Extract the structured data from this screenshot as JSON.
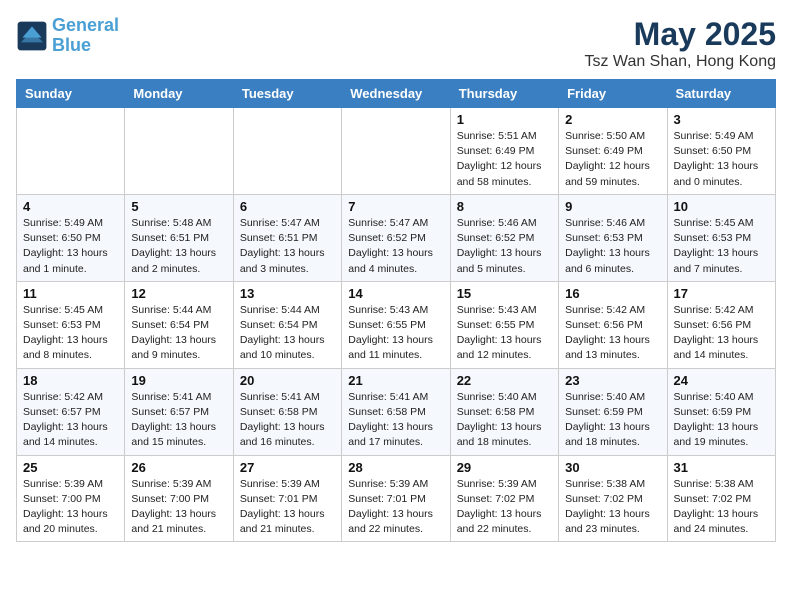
{
  "header": {
    "logo_line1": "General",
    "logo_line2": "Blue",
    "month_title": "May 2025",
    "location": "Tsz Wan Shan, Hong Kong"
  },
  "days_of_week": [
    "Sunday",
    "Monday",
    "Tuesday",
    "Wednesday",
    "Thursday",
    "Friday",
    "Saturday"
  ],
  "weeks": [
    [
      {
        "day": "",
        "info": ""
      },
      {
        "day": "",
        "info": ""
      },
      {
        "day": "",
        "info": ""
      },
      {
        "day": "",
        "info": ""
      },
      {
        "day": "1",
        "info": "Sunrise: 5:51 AM\nSunset: 6:49 PM\nDaylight: 12 hours\nand 58 minutes."
      },
      {
        "day": "2",
        "info": "Sunrise: 5:50 AM\nSunset: 6:49 PM\nDaylight: 12 hours\nand 59 minutes."
      },
      {
        "day": "3",
        "info": "Sunrise: 5:49 AM\nSunset: 6:50 PM\nDaylight: 13 hours\nand 0 minutes."
      }
    ],
    [
      {
        "day": "4",
        "info": "Sunrise: 5:49 AM\nSunset: 6:50 PM\nDaylight: 13 hours\nand 1 minute."
      },
      {
        "day": "5",
        "info": "Sunrise: 5:48 AM\nSunset: 6:51 PM\nDaylight: 13 hours\nand 2 minutes."
      },
      {
        "day": "6",
        "info": "Sunrise: 5:47 AM\nSunset: 6:51 PM\nDaylight: 13 hours\nand 3 minutes."
      },
      {
        "day": "7",
        "info": "Sunrise: 5:47 AM\nSunset: 6:52 PM\nDaylight: 13 hours\nand 4 minutes."
      },
      {
        "day": "8",
        "info": "Sunrise: 5:46 AM\nSunset: 6:52 PM\nDaylight: 13 hours\nand 5 minutes."
      },
      {
        "day": "9",
        "info": "Sunrise: 5:46 AM\nSunset: 6:53 PM\nDaylight: 13 hours\nand 6 minutes."
      },
      {
        "day": "10",
        "info": "Sunrise: 5:45 AM\nSunset: 6:53 PM\nDaylight: 13 hours\nand 7 minutes."
      }
    ],
    [
      {
        "day": "11",
        "info": "Sunrise: 5:45 AM\nSunset: 6:53 PM\nDaylight: 13 hours\nand 8 minutes."
      },
      {
        "day": "12",
        "info": "Sunrise: 5:44 AM\nSunset: 6:54 PM\nDaylight: 13 hours\nand 9 minutes."
      },
      {
        "day": "13",
        "info": "Sunrise: 5:44 AM\nSunset: 6:54 PM\nDaylight: 13 hours\nand 10 minutes."
      },
      {
        "day": "14",
        "info": "Sunrise: 5:43 AM\nSunset: 6:55 PM\nDaylight: 13 hours\nand 11 minutes."
      },
      {
        "day": "15",
        "info": "Sunrise: 5:43 AM\nSunset: 6:55 PM\nDaylight: 13 hours\nand 12 minutes."
      },
      {
        "day": "16",
        "info": "Sunrise: 5:42 AM\nSunset: 6:56 PM\nDaylight: 13 hours\nand 13 minutes."
      },
      {
        "day": "17",
        "info": "Sunrise: 5:42 AM\nSunset: 6:56 PM\nDaylight: 13 hours\nand 14 minutes."
      }
    ],
    [
      {
        "day": "18",
        "info": "Sunrise: 5:42 AM\nSunset: 6:57 PM\nDaylight: 13 hours\nand 14 minutes."
      },
      {
        "day": "19",
        "info": "Sunrise: 5:41 AM\nSunset: 6:57 PM\nDaylight: 13 hours\nand 15 minutes."
      },
      {
        "day": "20",
        "info": "Sunrise: 5:41 AM\nSunset: 6:58 PM\nDaylight: 13 hours\nand 16 minutes."
      },
      {
        "day": "21",
        "info": "Sunrise: 5:41 AM\nSunset: 6:58 PM\nDaylight: 13 hours\nand 17 minutes."
      },
      {
        "day": "22",
        "info": "Sunrise: 5:40 AM\nSunset: 6:58 PM\nDaylight: 13 hours\nand 18 minutes."
      },
      {
        "day": "23",
        "info": "Sunrise: 5:40 AM\nSunset: 6:59 PM\nDaylight: 13 hours\nand 18 minutes."
      },
      {
        "day": "24",
        "info": "Sunrise: 5:40 AM\nSunset: 6:59 PM\nDaylight: 13 hours\nand 19 minutes."
      }
    ],
    [
      {
        "day": "25",
        "info": "Sunrise: 5:39 AM\nSunset: 7:00 PM\nDaylight: 13 hours\nand 20 minutes."
      },
      {
        "day": "26",
        "info": "Sunrise: 5:39 AM\nSunset: 7:00 PM\nDaylight: 13 hours\nand 21 minutes."
      },
      {
        "day": "27",
        "info": "Sunrise: 5:39 AM\nSunset: 7:01 PM\nDaylight: 13 hours\nand 21 minutes."
      },
      {
        "day": "28",
        "info": "Sunrise: 5:39 AM\nSunset: 7:01 PM\nDaylight: 13 hours\nand 22 minutes."
      },
      {
        "day": "29",
        "info": "Sunrise: 5:39 AM\nSunset: 7:02 PM\nDaylight: 13 hours\nand 22 minutes."
      },
      {
        "day": "30",
        "info": "Sunrise: 5:38 AM\nSunset: 7:02 PM\nDaylight: 13 hours\nand 23 minutes."
      },
      {
        "day": "31",
        "info": "Sunrise: 5:38 AM\nSunset: 7:02 PM\nDaylight: 13 hours\nand 24 minutes."
      }
    ]
  ]
}
